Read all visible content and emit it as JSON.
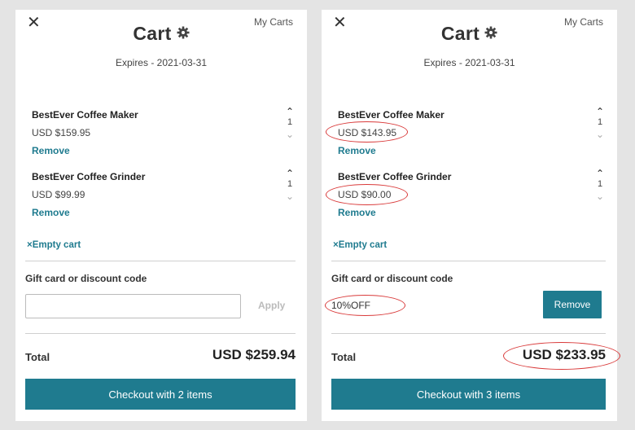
{
  "panels": [
    {
      "close_glyph": "✕",
      "my_carts": "My Carts",
      "title": "Cart",
      "expires": "Expires - 2021-03-31",
      "items": [
        {
          "name": "BestEver Coffee Maker",
          "price": "USD $159.95",
          "remove": "Remove",
          "qty": "1"
        },
        {
          "name": "BestEver Coffee Grinder",
          "price": "USD $99.99",
          "remove": "Remove",
          "qty": "1"
        }
      ],
      "empty_cart": "Empty cart",
      "gift_label": "Gift card or discount code",
      "gift_value": "",
      "apply": "Apply",
      "total_label": "Total",
      "total_value": "USD $259.94",
      "checkout": "Checkout with 2 items"
    },
    {
      "close_glyph": "✕",
      "my_carts": "My Carts",
      "title": "Cart",
      "expires": "Expires - 2021-03-31",
      "items": [
        {
          "name": "BestEver Coffee Maker",
          "price": "USD $143.95",
          "remove": "Remove",
          "qty": "1"
        },
        {
          "name": "BestEver Coffee Grinder",
          "price": "USD $90.00",
          "remove": "Remove",
          "qty": "1"
        }
      ],
      "empty_cart": "Empty cart",
      "gift_label": "Gift card or discount code",
      "gift_value": "10%OFF",
      "remove_code": "Remove",
      "total_label": "Total",
      "total_value": "USD $233.95",
      "checkout": "Checkout with 3 items"
    }
  ],
  "colors": {
    "accent": "#1f7b8f",
    "annotation": "#d93a3a",
    "background": "#e4e4e4"
  },
  "icons": {
    "close": "close-icon",
    "settings": "gear-icon",
    "qty_up": "chevron-up-icon",
    "qty_down": "chevron-down-icon",
    "empty": "x-icon"
  }
}
